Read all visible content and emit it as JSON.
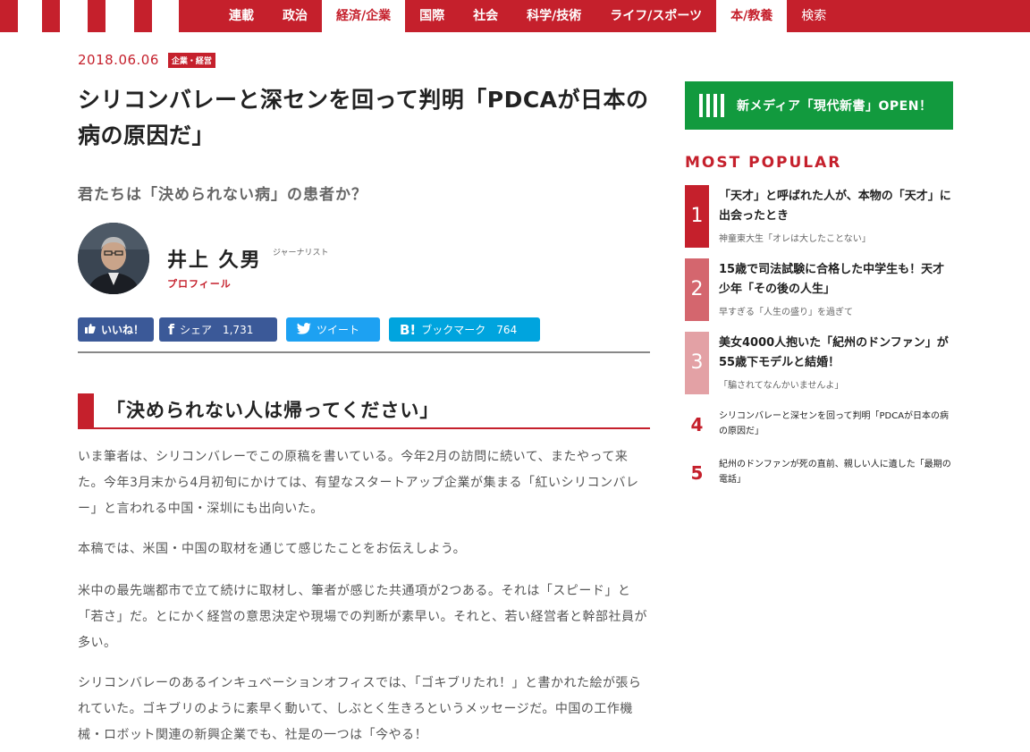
{
  "nav": {
    "items": [
      {
        "label": "連載",
        "active": false
      },
      {
        "label": "政治",
        "active": false
      },
      {
        "label": "経済/企業",
        "active": true
      },
      {
        "label": "国際",
        "active": false
      },
      {
        "label": "社会",
        "active": false
      },
      {
        "label": "科学/技術",
        "active": false
      },
      {
        "label": "ライフ/スポーツ",
        "active": false
      },
      {
        "label": "本/教養",
        "active": true
      }
    ],
    "search_label": "検索"
  },
  "article": {
    "date": "2018.06.06",
    "category": "企業・経営",
    "title": "シリコンバレーと深センを回って判明「PDCAが日本の病の原因だ」",
    "subtitle": "君たちは「決められない病」の患者か？",
    "author": {
      "name": "井上 久男",
      "role": "ジャーナリスト",
      "profile_link": "プロフィール"
    },
    "share": {
      "like_label": "いいね！",
      "facebook_label": "シェア",
      "facebook_count": "1,731",
      "twitter_label": "ツイート",
      "hatena_label": "ブックマーク",
      "hatena_count": "764"
    },
    "section_heading": "「決められない人は帰ってください」",
    "paragraphs": [
      "いま筆者は、シリコンバレーでこの原稿を書いている。今年2月の訪問に続いて、またやって来た。今年3月末から4月初旬にかけては、有望なスタートアップ企業が集まる「紅いシリコンバレー」と言われる中国・深圳にも出向いた。",
      "本稿では、米国・中国の取材を通じて感じたことをお伝えしよう。",
      "米中の最先端都市で立て続けに取材し、筆者が感じた共通項が2つある。それは「スピード」と「若さ」だ。とにかく経営の意思決定や現場での判断が素早い。それと、若い経営者と幹部社員が多い。",
      "シリコンバレーのあるインキュベーションオフィスでは、「ゴキブリたれ！」と書かれた絵が張られていた。ゴキブリのように素早く動いて、しぶとく生きろというメッセージだ。中国の工作機械・ロボット関連の新興企業でも、社是の一つは「今やる！"
    ]
  },
  "sidebar": {
    "promo_label": "新メディア「現代新書」OPEN！",
    "popular_heading": "MOST POPULAR",
    "ranking": [
      {
        "rank": "1",
        "title": "「天才」と呼ばれた人が、本物の「天才」に出会ったとき",
        "sub": "神童東大生「オレは大したことない」",
        "color": "#c5202c"
      },
      {
        "rank": "2",
        "title": "15歳で司法試験に合格した中学生も！天才少年「その後の人生」",
        "sub": "早すぎる「人生の盛り」を過ぎて",
        "color": "#d4666e"
      },
      {
        "rank": "3",
        "title": "美女4000人抱いた「紀州のドンファン」が55歳下モデルと結婚！",
        "sub": "「騙されてなんかいませんよ」",
        "color": "#e3a1a5"
      },
      {
        "rank": "4",
        "title": "シリコンバレーと深センを回って判明「PDCAが日本の病の原因だ」"
      },
      {
        "rank": "5",
        "title": "紀州のドンファンが死の直前、親しい人に遺した「最期の電話」"
      }
    ]
  },
  "colors": {
    "brand_red": "#c5202c",
    "facebook": "#3b5998",
    "twitter": "#1da1f2",
    "hatena": "#00a4de",
    "promo_green": "#129a3e"
  }
}
